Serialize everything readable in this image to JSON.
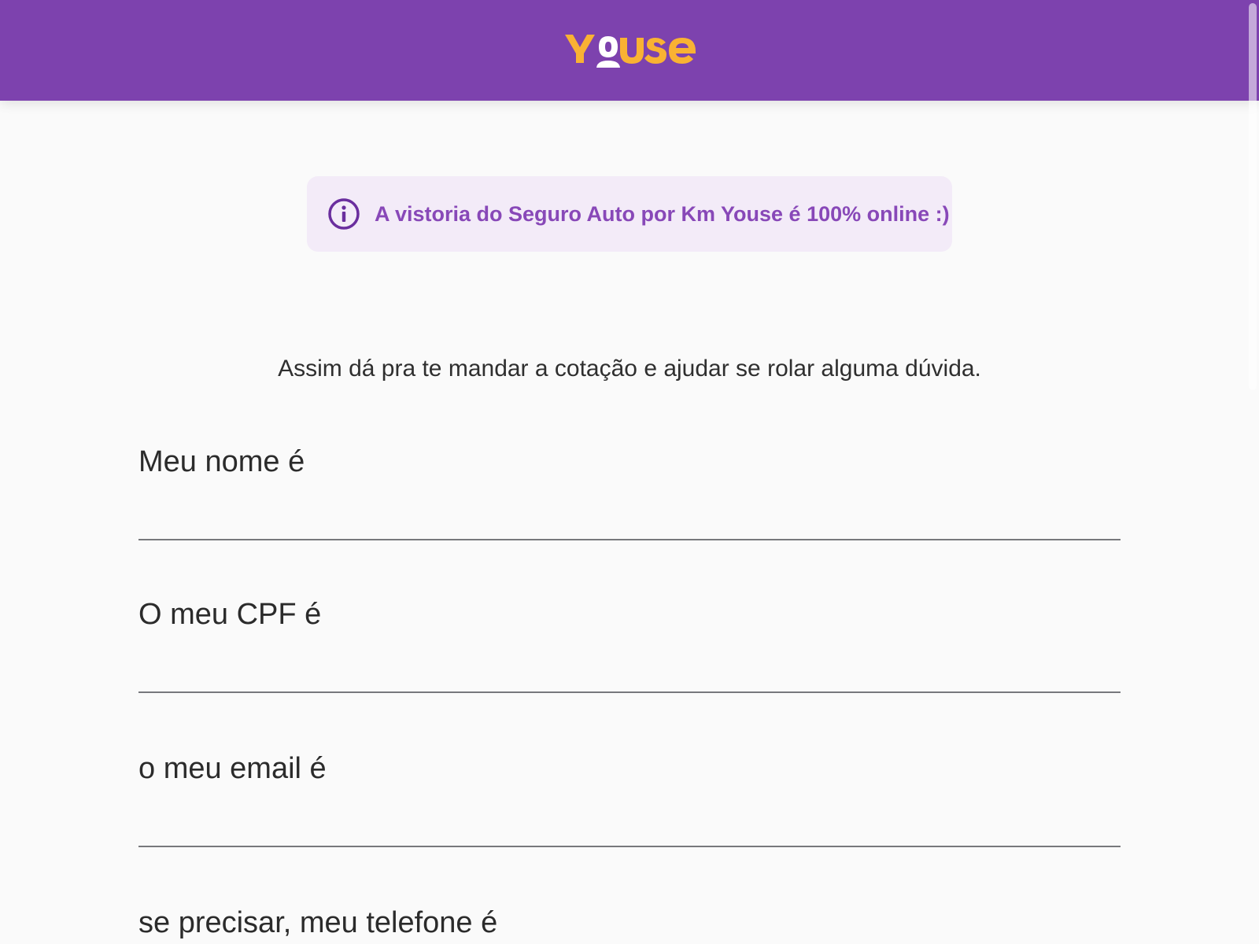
{
  "header": {
    "logo_text": "YOUSE",
    "background_color": "#7d42ae",
    "logo_color": "#f9b233"
  },
  "banner": {
    "icon": "info-icon",
    "text": "A vistoria do Seguro Auto por Km Youse é 100% online :)",
    "background_color": "#f3ebf8",
    "text_color": "#8848b8"
  },
  "form": {
    "subtitle": "Assim dá pra te mandar a cotação e ajudar se rolar alguma dúvida.",
    "fields": [
      {
        "label": "Meu nome é",
        "value": "",
        "placeholder": ""
      },
      {
        "label": "O meu CPF é",
        "value": "",
        "placeholder": ""
      },
      {
        "label": "o meu email é",
        "value": "",
        "placeholder": ""
      },
      {
        "label": "se precisar, meu telefone é",
        "value": "",
        "placeholder": ""
      }
    ]
  }
}
